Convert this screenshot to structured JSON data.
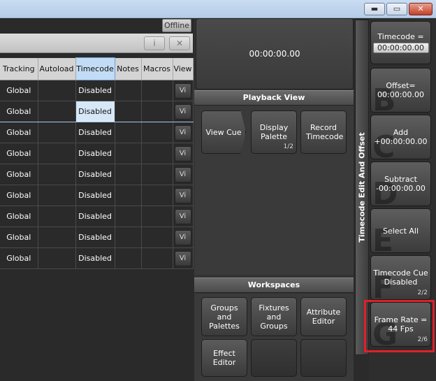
{
  "window": {
    "minimize": "▬",
    "maximize": "▭",
    "close": "✕"
  },
  "status": {
    "offline": "Offline"
  },
  "panel_header": {
    "info_label": "i",
    "close_label": "✕"
  },
  "grid": {
    "columns": [
      "Tracking",
      "Autoload",
      "Timecode",
      "Notes",
      "Macros",
      "View"
    ],
    "selected_column": "Timecode",
    "rows": [
      {
        "tracking": "Global",
        "autoload": "",
        "timecode": "Disabled",
        "notes": "",
        "macros": "",
        "view": "Vi"
      },
      {
        "tracking": "Global",
        "autoload": "",
        "timecode": "Disabled",
        "notes": "",
        "macros": "",
        "view": "Vi"
      },
      {
        "tracking": "Global",
        "autoload": "",
        "timecode": "Disabled",
        "notes": "",
        "macros": "",
        "view": "Vi"
      },
      {
        "tracking": "Global",
        "autoload": "",
        "timecode": "Disabled",
        "notes": "",
        "macros": "",
        "view": "Vi"
      },
      {
        "tracking": "Global",
        "autoload": "",
        "timecode": "Disabled",
        "notes": "",
        "macros": "",
        "view": "Vi"
      },
      {
        "tracking": "Global",
        "autoload": "",
        "timecode": "Disabled",
        "notes": "",
        "macros": "",
        "view": "Vi"
      },
      {
        "tracking": "Global",
        "autoload": "",
        "timecode": "Disabled",
        "notes": "",
        "macros": "",
        "view": "Vi"
      },
      {
        "tracking": "Global",
        "autoload": "",
        "timecode": "Disabled",
        "notes": "",
        "macros": "",
        "view": "Vi"
      },
      {
        "tracking": "Global",
        "autoload": "",
        "timecode": "Disabled",
        "notes": "",
        "macros": "",
        "view": "Vi"
      }
    ]
  },
  "timecode_display": "00:00:00.00",
  "playback_view": {
    "title": "Playback View",
    "buttons": [
      {
        "label": "View Cue"
      },
      {
        "label": "Display Palette",
        "page": "1/2"
      },
      {
        "label": "Record Timecode"
      }
    ]
  },
  "workspaces": {
    "title": "Workspaces",
    "buttons": [
      {
        "label": "Groups and Palettes"
      },
      {
        "label": "Fixtures and Groups"
      },
      {
        "label": "Attribute Editor"
      },
      {
        "label": "Effect Editor"
      },
      {
        "label": ""
      },
      {
        "label": ""
      }
    ]
  },
  "side_panel": {
    "title": "Timecode Edit And Offset",
    "keys": [
      {
        "ghost": "",
        "label": "Timecode =",
        "value": "00:00:00.00",
        "page": ""
      },
      {
        "ghost": "B",
        "label": "Offset=\n00:00:00.00",
        "page": ""
      },
      {
        "ghost": "C",
        "label": "Add\n+00:00:00.00",
        "page": ""
      },
      {
        "ghost": "D",
        "label": "Subtract\n-00:00:00.00",
        "page": ""
      },
      {
        "ghost": "E",
        "label": "Select All",
        "page": ""
      },
      {
        "ghost": "F",
        "label": "Timecode Cue\nDisabled",
        "page": "2/2"
      },
      {
        "ghost": "G",
        "label": "Frame Rate =\n44 Fps",
        "page": "2/6"
      }
    ]
  }
}
